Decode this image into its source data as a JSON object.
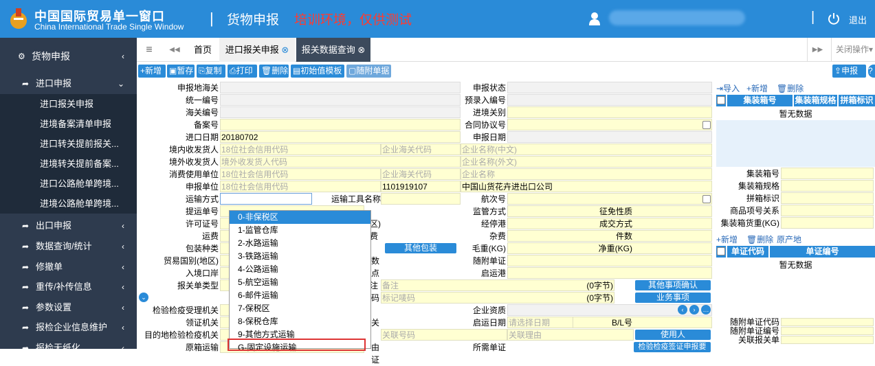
{
  "header": {
    "title_cn": "中国国际贸易单一窗口",
    "title_en": "China International Trade Single Window",
    "section": "货物申报",
    "notice": "培训环境，仅供测试",
    "logout": "退出",
    "sep": "|"
  },
  "sidebar": {
    "top": {
      "label": "货物申报"
    },
    "items": [
      {
        "label": "进口申报",
        "ar": "⌄"
      },
      {
        "label": "出口申报",
        "ar": "‹"
      },
      {
        "label": "数据查询/统计",
        "ar": "‹"
      },
      {
        "label": "修撤单",
        "ar": "‹"
      },
      {
        "label": "重传/补传信息",
        "ar": "‹"
      },
      {
        "label": "参数设置",
        "ar": "‹"
      },
      {
        "label": "报检企业信息维护",
        "ar": "‹"
      },
      {
        "label": "报检无纸化",
        "ar": "‹"
      }
    ],
    "subitems": [
      "进口报关申报",
      "进境备案清单申报",
      "进口转关提前报关...",
      "进境转关提前备案...",
      "进口公路舱单跨境...",
      "进境公路舱单跨境..."
    ]
  },
  "tabs": {
    "menu": "≡",
    "back": "◀◀",
    "home": "首页",
    "t1": "进口报关申报",
    "t2": "报关数据查询",
    "fwd": "▶▶",
    "close_ops": "关闭操作"
  },
  "toolbar": {
    "add": "新增",
    "save": "暂存",
    "copy": "复制",
    "print": "打印",
    "delete": "删除",
    "template": "初始值模板",
    "attach": "随附单据",
    "declare": "申报"
  },
  "form": {
    "l": [
      "申报地海关",
      "统一编号",
      "海关编号",
      "备案号",
      "进口日期",
      "境内收发货人",
      "境外收发货人",
      "消费使用单位",
      "申报单位",
      "运输方式",
      "提运单号",
      "许可证号",
      "运费",
      "包装种类",
      "贸易国别(地区)",
      "入境口岸",
      "报关单类型",
      "",
      "检验检疫受理机关",
      "领证机关",
      "目的地检验检疫机关",
      "原箱运输"
    ],
    "r": [
      "申报状态",
      "预录入编号",
      "进境关别",
      "合同协议号",
      "申报日期",
      "",
      "",
      "",
      "",
      "航次号",
      "监管方式",
      "经停港",
      "杂费",
      "毛重(KG)",
      "随附单证",
      "启运港",
      "",
      "",
      "企业资质",
      "启运日期",
      "",
      "所需单证"
    ],
    "import_date": "20180702",
    "declarant_code": "1101919107",
    "declarant_name": "中国山货花卉进出口公司",
    "transport_tool": "运输工具名称",
    "ph_credit": "18位社会信用代码",
    "ph_customs": "企业海关代码",
    "ph_name_cn": "企业名称(中文)",
    "ph_name_en": "企业名称(外文)",
    "ph_overseas": "境外收发货人代码",
    "ph_name": "企业名称",
    "ph_note": "备注",
    "ph_mark": "标记唛码",
    "ph_date": "请选择日期",
    "ph_rel_no": "关联号码",
    "ph_rel_reason": "关联理由",
    "exempt": "征免性质",
    "deal_mode": "成交方式",
    "pieces": "件数",
    "net_wt": "净重(KG)",
    "bl_no": "B/L号",
    "other_pack": "其他包装",
    "other_confirm": "其他事项确认",
    "business": "业务事项",
    "user": "使用人",
    "bytes0": "(0字节)",
    "bytes0b": "(0字节)",
    "insp_cert": "检验检疫签证申报要",
    "frag": {
      "qu": "区)",
      "fei": "费",
      "shu": "数",
      "dian": "点",
      "zhu": "注",
      "ma": "码",
      "guan": "关",
      "you": "由",
      "zheng": "证"
    }
  },
  "dropdown": {
    "items": [
      "0-非保税区",
      "1-监管仓库",
      "2-水路运输",
      "3-铁路运输",
      "4-公路运输",
      "5-航空运输",
      "6-邮件运输",
      "7-保税区",
      "8-保税仓库",
      "9-其他方式运输",
      "G-固定设施运输"
    ]
  },
  "right": {
    "import": "导入",
    "add": "新增",
    "del": "删除",
    "cols1": [
      "集装箱号",
      "集装箱规格",
      "拼箱标识"
    ],
    "nodata1": "暂无数据",
    "labels": [
      "集装箱号",
      "集装箱规格",
      "拼箱标识",
      "商品项号关系",
      "集装箱货重(KG)"
    ],
    "add2": "新增",
    "del2": "删除",
    "origin": "原产地",
    "cols2": [
      "单证代码",
      "单证编号"
    ],
    "nodata2": "暂无数据",
    "labels2": [
      "随附单证代码",
      "随附单证编号",
      "关联报关单"
    ]
  }
}
